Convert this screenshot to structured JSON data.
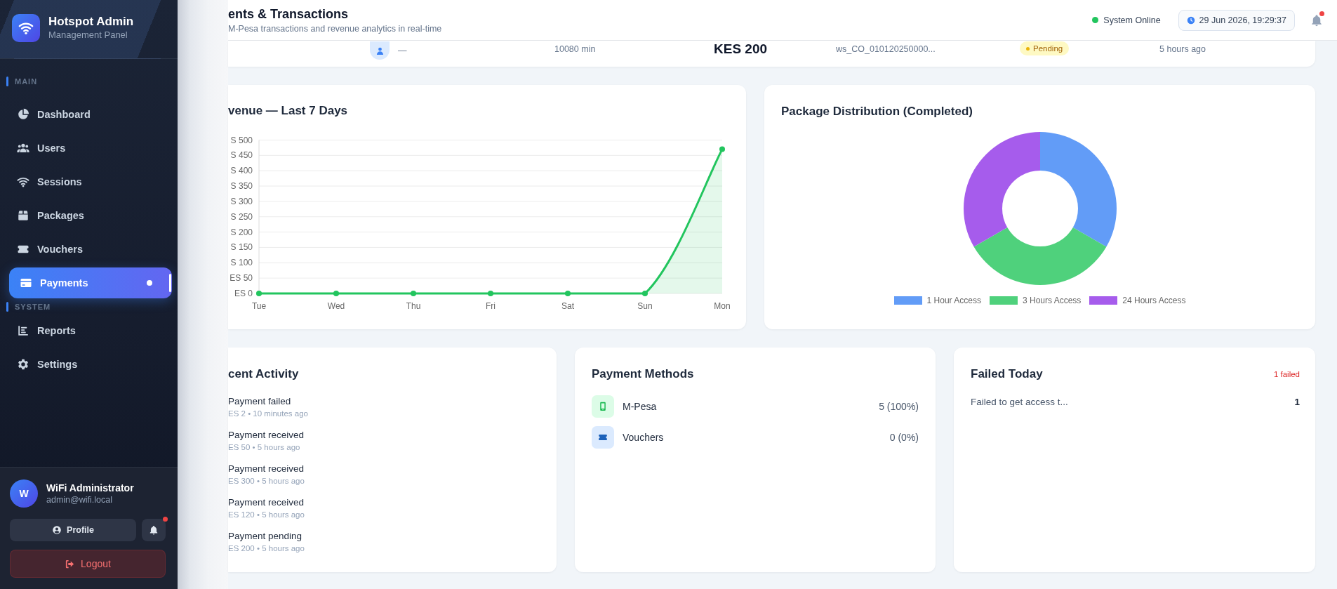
{
  "sidebar": {
    "brand": {
      "title": "Hotspot Admin",
      "subtitle": "Management Panel"
    },
    "sections": [
      {
        "label": "MAIN",
        "items": [
          {
            "label": "Dashboard",
            "selected": false
          },
          {
            "label": "Users",
            "selected": false
          },
          {
            "label": "Sessions",
            "selected": false
          },
          {
            "label": "Packages",
            "selected": false
          },
          {
            "label": "Vouchers",
            "selected": false
          },
          {
            "label": "Payments",
            "selected": true
          }
        ]
      },
      {
        "label": "SYSTEM",
        "items": [
          {
            "label": "Reports",
            "selected": false
          },
          {
            "label": "Settings",
            "selected": false
          }
        ]
      }
    ],
    "user": {
      "initial": "W",
      "name": "WiFi Administrator",
      "email": "admin@wifi.local"
    },
    "profile_button": "Profile",
    "notifications": {
      "unread": true
    },
    "logout_button": "Logout"
  },
  "header": {
    "title": "ents & Transactions",
    "subtitle": "M-Pesa transactions and revenue analytics in real-time",
    "status": {
      "label": "System Online",
      "online": true
    },
    "datetime": "29 Jun 2026, 19:29:37",
    "notifications": {
      "unread": true
    }
  },
  "transaction_row": {
    "customer": "—",
    "duration": "10080 min",
    "amount": "KES 200",
    "reference": "ws_CO_010120250000...",
    "status": "Pending",
    "time": "5 hours ago"
  },
  "revenue_chart": {
    "ytick_prefixes": [
      "S",
      "S",
      "S",
      "S",
      "S",
      "S",
      "S",
      "S",
      "S",
      "ES",
      "ES"
    ],
    "chart_data": {
      "type": "area",
      "title": "venue — Last 7 Days",
      "categories": [
        "Tue",
        "Wed",
        "Thu",
        "Fri",
        "Sat",
        "Sun",
        "Mon"
      ],
      "series": [
        {
          "color": "#22c55e",
          "values": [
            0,
            0,
            0,
            0,
            0,
            0,
            470
          ]
        }
      ],
      "ylim": [
        0,
        500
      ],
      "yticks": [
        500,
        450,
        400,
        350,
        300,
        250,
        200,
        150,
        100,
        50,
        0
      ],
      "grid": true
    }
  },
  "package_chart": {
    "chart_data": {
      "type": "donut",
      "title": "Package Distribution (Completed)",
      "categories": [
        "1 Hour Access",
        "3 Hours Access",
        "24 Hours Access"
      ],
      "values": [
        1,
        1,
        1
      ],
      "colors": [
        "#629cf7",
        "#4fd17c",
        "#a65cec"
      ],
      "legend": "bottom"
    }
  },
  "recent_activity": {
    "title": "cent Activity",
    "items": [
      {
        "title": "Payment failed",
        "detail": "ES 2 • 10 minutes ago"
      },
      {
        "title": "Payment received",
        "detail": "ES 50 • 5 hours ago"
      },
      {
        "title": "Payment received",
        "detail": "ES 300 • 5 hours ago"
      },
      {
        "title": "Payment received",
        "detail": "ES 120 • 5 hours ago"
      },
      {
        "title": "Payment pending",
        "detail": "ES 200 • 5 hours ago"
      }
    ]
  },
  "payment_methods": {
    "title": "Payment Methods",
    "items": [
      {
        "name": "M-Pesa",
        "count": "5 (100%)",
        "color": "#dcfce7"
      },
      {
        "name": "Vouchers",
        "count": "0 (0%)",
        "color": "#dbeafe"
      }
    ]
  },
  "failed_today": {
    "title": "Failed Today",
    "badge": "1 failed",
    "items": [
      {
        "label": "Failed to get access t...",
        "count": "1"
      }
    ]
  }
}
